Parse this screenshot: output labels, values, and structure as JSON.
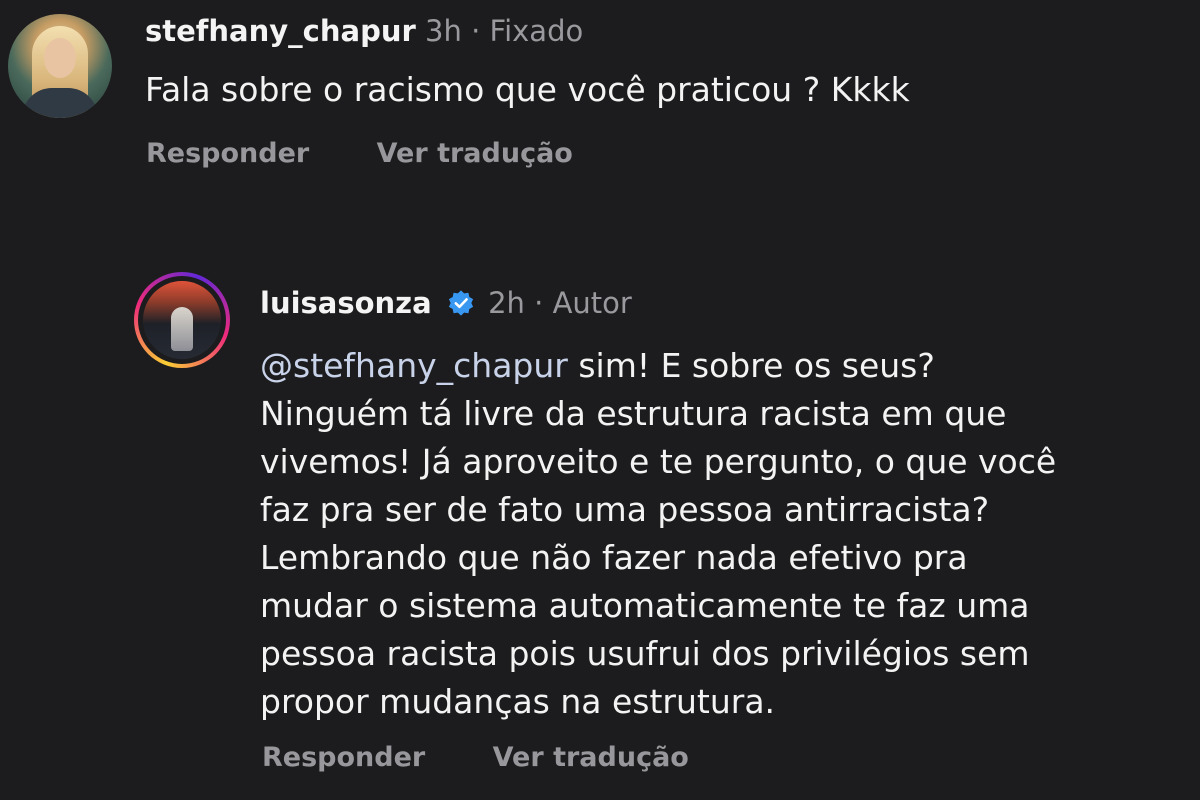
{
  "comments": [
    {
      "username": "stefhany_chapur",
      "time": "3h",
      "separator": "·",
      "tag": "Fixado",
      "text_lines": [
        "Fala sobre o racismo que você praticou ? Kkkk"
      ],
      "actions": {
        "reply": "Responder",
        "translate": "Ver tradução"
      }
    },
    {
      "username": "luisasonza",
      "verified": true,
      "time": "2h",
      "separator": "·",
      "tag": "Autor",
      "mention": "@stefhany_chapur",
      "text_lines": [
        " sim! E sobre os seus?",
        "Ninguém tá livre da estrutura racista em que",
        "vivemos! Já aproveito e te pergunto, o que você",
        "faz pra ser de fato uma pessoa antirracista?",
        "Lembrando que não fazer nada efetivo pra",
        "mudar o sistema automaticamente te faz uma",
        "pessoa racista pois usufrui dos privilégios sem",
        "propor mudanças na estrutura."
      ],
      "actions": {
        "reply": "Responder",
        "translate": "Ver tradução"
      }
    }
  ],
  "colors": {
    "background": "#1c1c1e",
    "text": "#f3f3f3",
    "muted": "#9a9a9e",
    "verified": "#3897f0",
    "mention": "#c8d3ea"
  },
  "icons": {
    "verified": "verified-badge-icon"
  }
}
